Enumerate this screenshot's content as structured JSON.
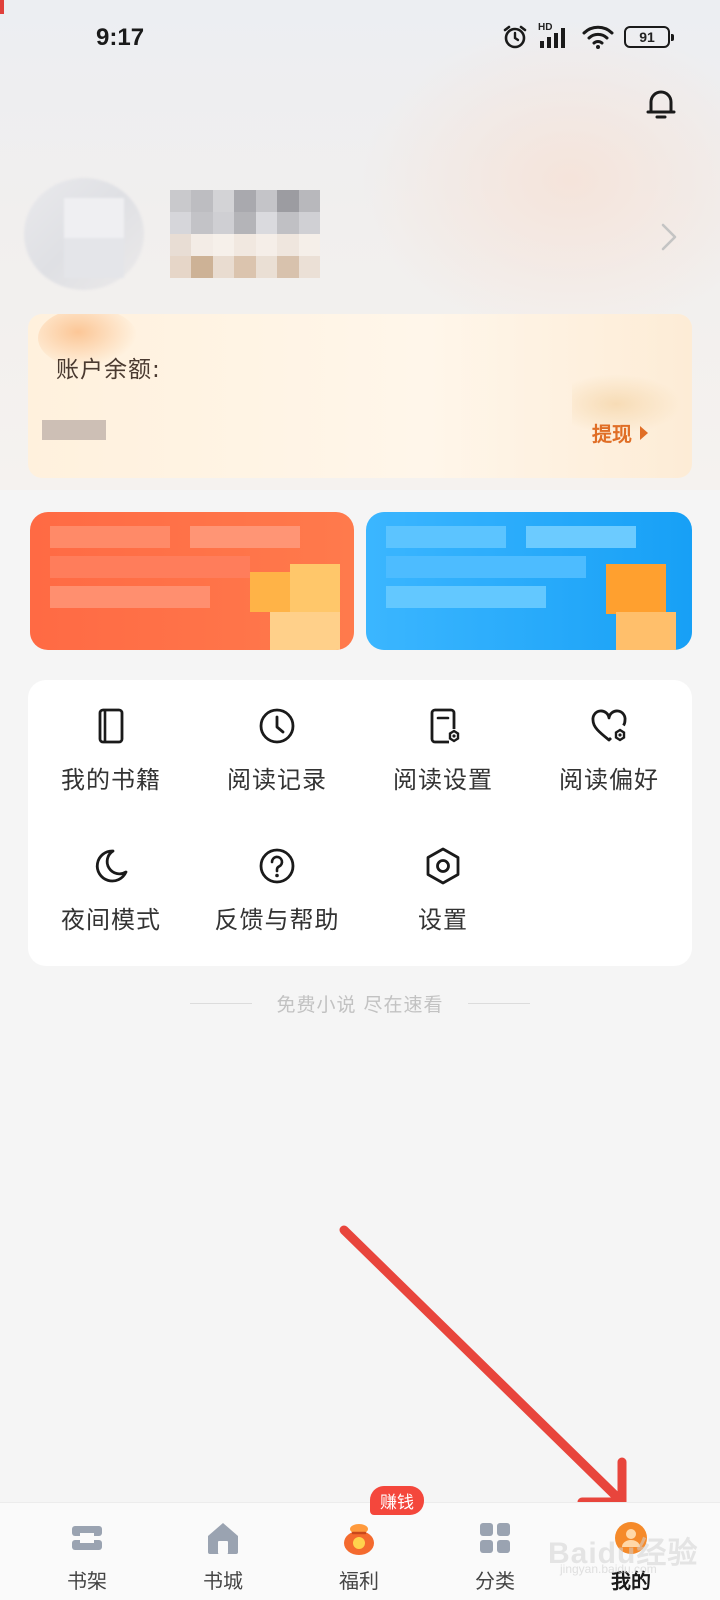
{
  "status_bar": {
    "time": "9:17",
    "network": "HD",
    "battery": "91"
  },
  "balance": {
    "label": "账户余额:",
    "withdraw_label": "提现"
  },
  "menu": {
    "items": [
      {
        "label": "我的书籍",
        "icon": "book-icon"
      },
      {
        "label": "阅读记录",
        "icon": "clock-icon"
      },
      {
        "label": "阅读设置",
        "icon": "reading-settings-icon"
      },
      {
        "label": "阅读偏好",
        "icon": "heart-settings-icon"
      },
      {
        "label": "夜间模式",
        "icon": "moon-icon"
      },
      {
        "label": "反馈与帮助",
        "icon": "help-icon"
      },
      {
        "label": "设置",
        "icon": "settings-icon"
      }
    ]
  },
  "slogan": "免费小说 尽在速看",
  "tab_bar": {
    "tabs": [
      {
        "label": "书架",
        "icon": "bookshelf-icon",
        "active": false
      },
      {
        "label": "书城",
        "icon": "home-icon",
        "active": false
      },
      {
        "label": "福利",
        "icon": "gift-bag-icon",
        "active": false
      },
      {
        "label": "分类",
        "icon": "grid-icon",
        "active": false
      },
      {
        "label": "我的",
        "icon": "profile-icon",
        "active": true
      }
    ],
    "earn_badge": "赚钱"
  },
  "watermark": {
    "text": "Baidu经验",
    "sub": "jingyan.baidu.com"
  },
  "colors": {
    "accent_orange": "#e06e26",
    "promo_orange": "#ff6a44",
    "promo_blue": "#17a0f6",
    "badge_red": "#f4473c",
    "annotation_red": "#e8453c"
  }
}
